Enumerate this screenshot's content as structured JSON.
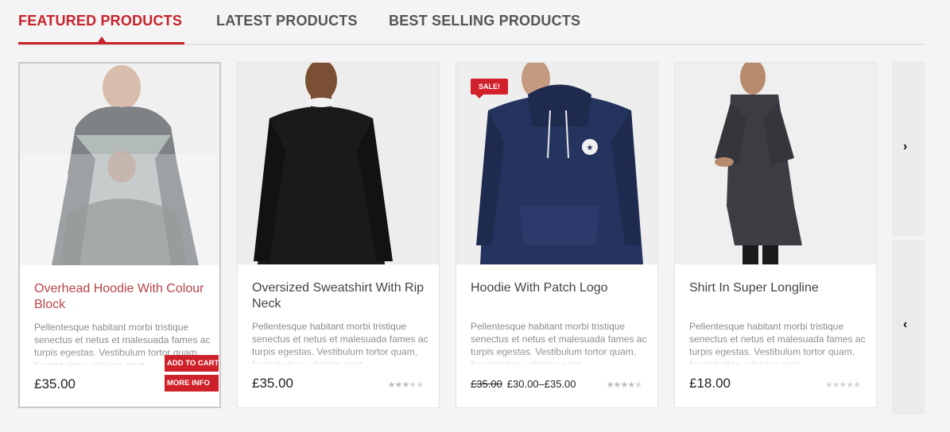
{
  "tabs": [
    {
      "label": "FEATURED PRODUCTS",
      "active": true
    },
    {
      "label": "LATEST PRODUCTS",
      "active": false
    },
    {
      "label": "BEST SELLING PRODUCTS",
      "active": false
    }
  ],
  "colors": {
    "accent": "#c8232c",
    "background": "#f4f4f4"
  },
  "products": [
    {
      "title": "Overhead Hoodie With Colour Block",
      "description": "Pellentesque habitant morbi tristique senectus et netus et malesuada fames ac turpis egestas. Vestibulum tortor quam, feugiat vitae, ultricies eget",
      "price": "£35.00",
      "rating": 0,
      "buttons": {
        "add_to_cart": "ADD TO CART",
        "more_info": "MORE INFO"
      },
      "image_icon": "hoodie-grey-image"
    },
    {
      "title": "Oversized Sweatshirt With Rip Neck",
      "description": "Pellentesque habitant morbi tristique senectus et netus et malesuada fames ac turpis egestas. Vestibulum tortor quam, feugiat vitae, ultricies eget",
      "price": "£35.00",
      "rating": 3,
      "image_icon": "sweatshirt-black-image"
    },
    {
      "title": "Hoodie With Patch Logo",
      "description": "Pellentesque habitant morbi tristique senectus et netus et malesuada fames ac turpis egestas. Vestibulum tortor quam, feugiat vitae, ultricies eget",
      "price_old": "£35.00",
      "price_range": "£30.00–£35.00",
      "badge": "SALE!",
      "rating": 4,
      "image_icon": "hoodie-navy-image"
    },
    {
      "title": "Shirt In Super Longline",
      "description": "Pellentesque habitant morbi tristique senectus et netus et malesuada fames ac turpis egestas. Vestibulum tortor quam, feugiat vitae, ultricies eget",
      "price": "£18.00",
      "rating": 0,
      "image_icon": "shirt-charcoal-image"
    }
  ],
  "carousel": {
    "next": "›",
    "prev": "‹"
  },
  "stars_glyph": "★★★★★"
}
